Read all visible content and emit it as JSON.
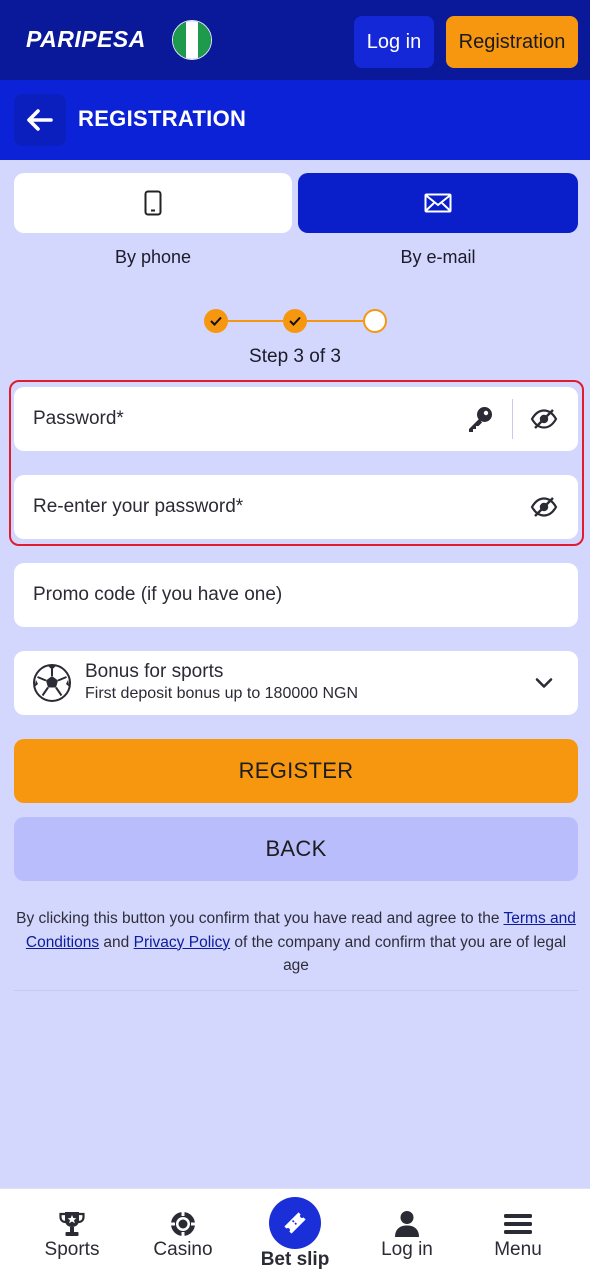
{
  "header": {
    "logo_text": "PARIPESA",
    "login_label": "Log in",
    "registration_label": "Registration"
  },
  "titlebar": {
    "title": "REGISTRATION"
  },
  "methods": {
    "phone_label": "By phone",
    "email_label": "By e-mail",
    "active": "email"
  },
  "steps": {
    "text": "Step 3 of 3",
    "current": 3,
    "total": 3
  },
  "form": {
    "password_placeholder": "Password*",
    "reenter_placeholder": "Re-enter your password*",
    "promo_placeholder": "Promo code (if you have one)",
    "bonus_title": "Bonus for sports",
    "bonus_subtitle": "First deposit bonus up to 180000 NGN"
  },
  "actions": {
    "register_label": "REGISTER",
    "back_label": "BACK"
  },
  "terms": {
    "part1": "By clicking this button you confirm that you have read and agree to the ",
    "terms_link": "Terms and Conditions",
    "part2": " and ",
    "privacy_link": "Privacy Policy",
    "part3": " of the company and confirm that you are of legal age"
  },
  "bottom_nav": {
    "items": [
      {
        "label": "Sports",
        "icon": "trophy-icon"
      },
      {
        "label": "Casino",
        "icon": "casino-chip-icon"
      },
      {
        "label": "Bet slip",
        "icon": "ticket-icon"
      },
      {
        "label": "Log in",
        "icon": "user-icon"
      },
      {
        "label": "Menu",
        "icon": "hamburger-icon"
      }
    ]
  },
  "colors": {
    "header_bg": "#0a189a",
    "titlebar_bg": "#0c22d6",
    "page_bg": "#d3d6fd",
    "accent_orange": "#f7960f",
    "highlight_red": "#e01c2d"
  }
}
